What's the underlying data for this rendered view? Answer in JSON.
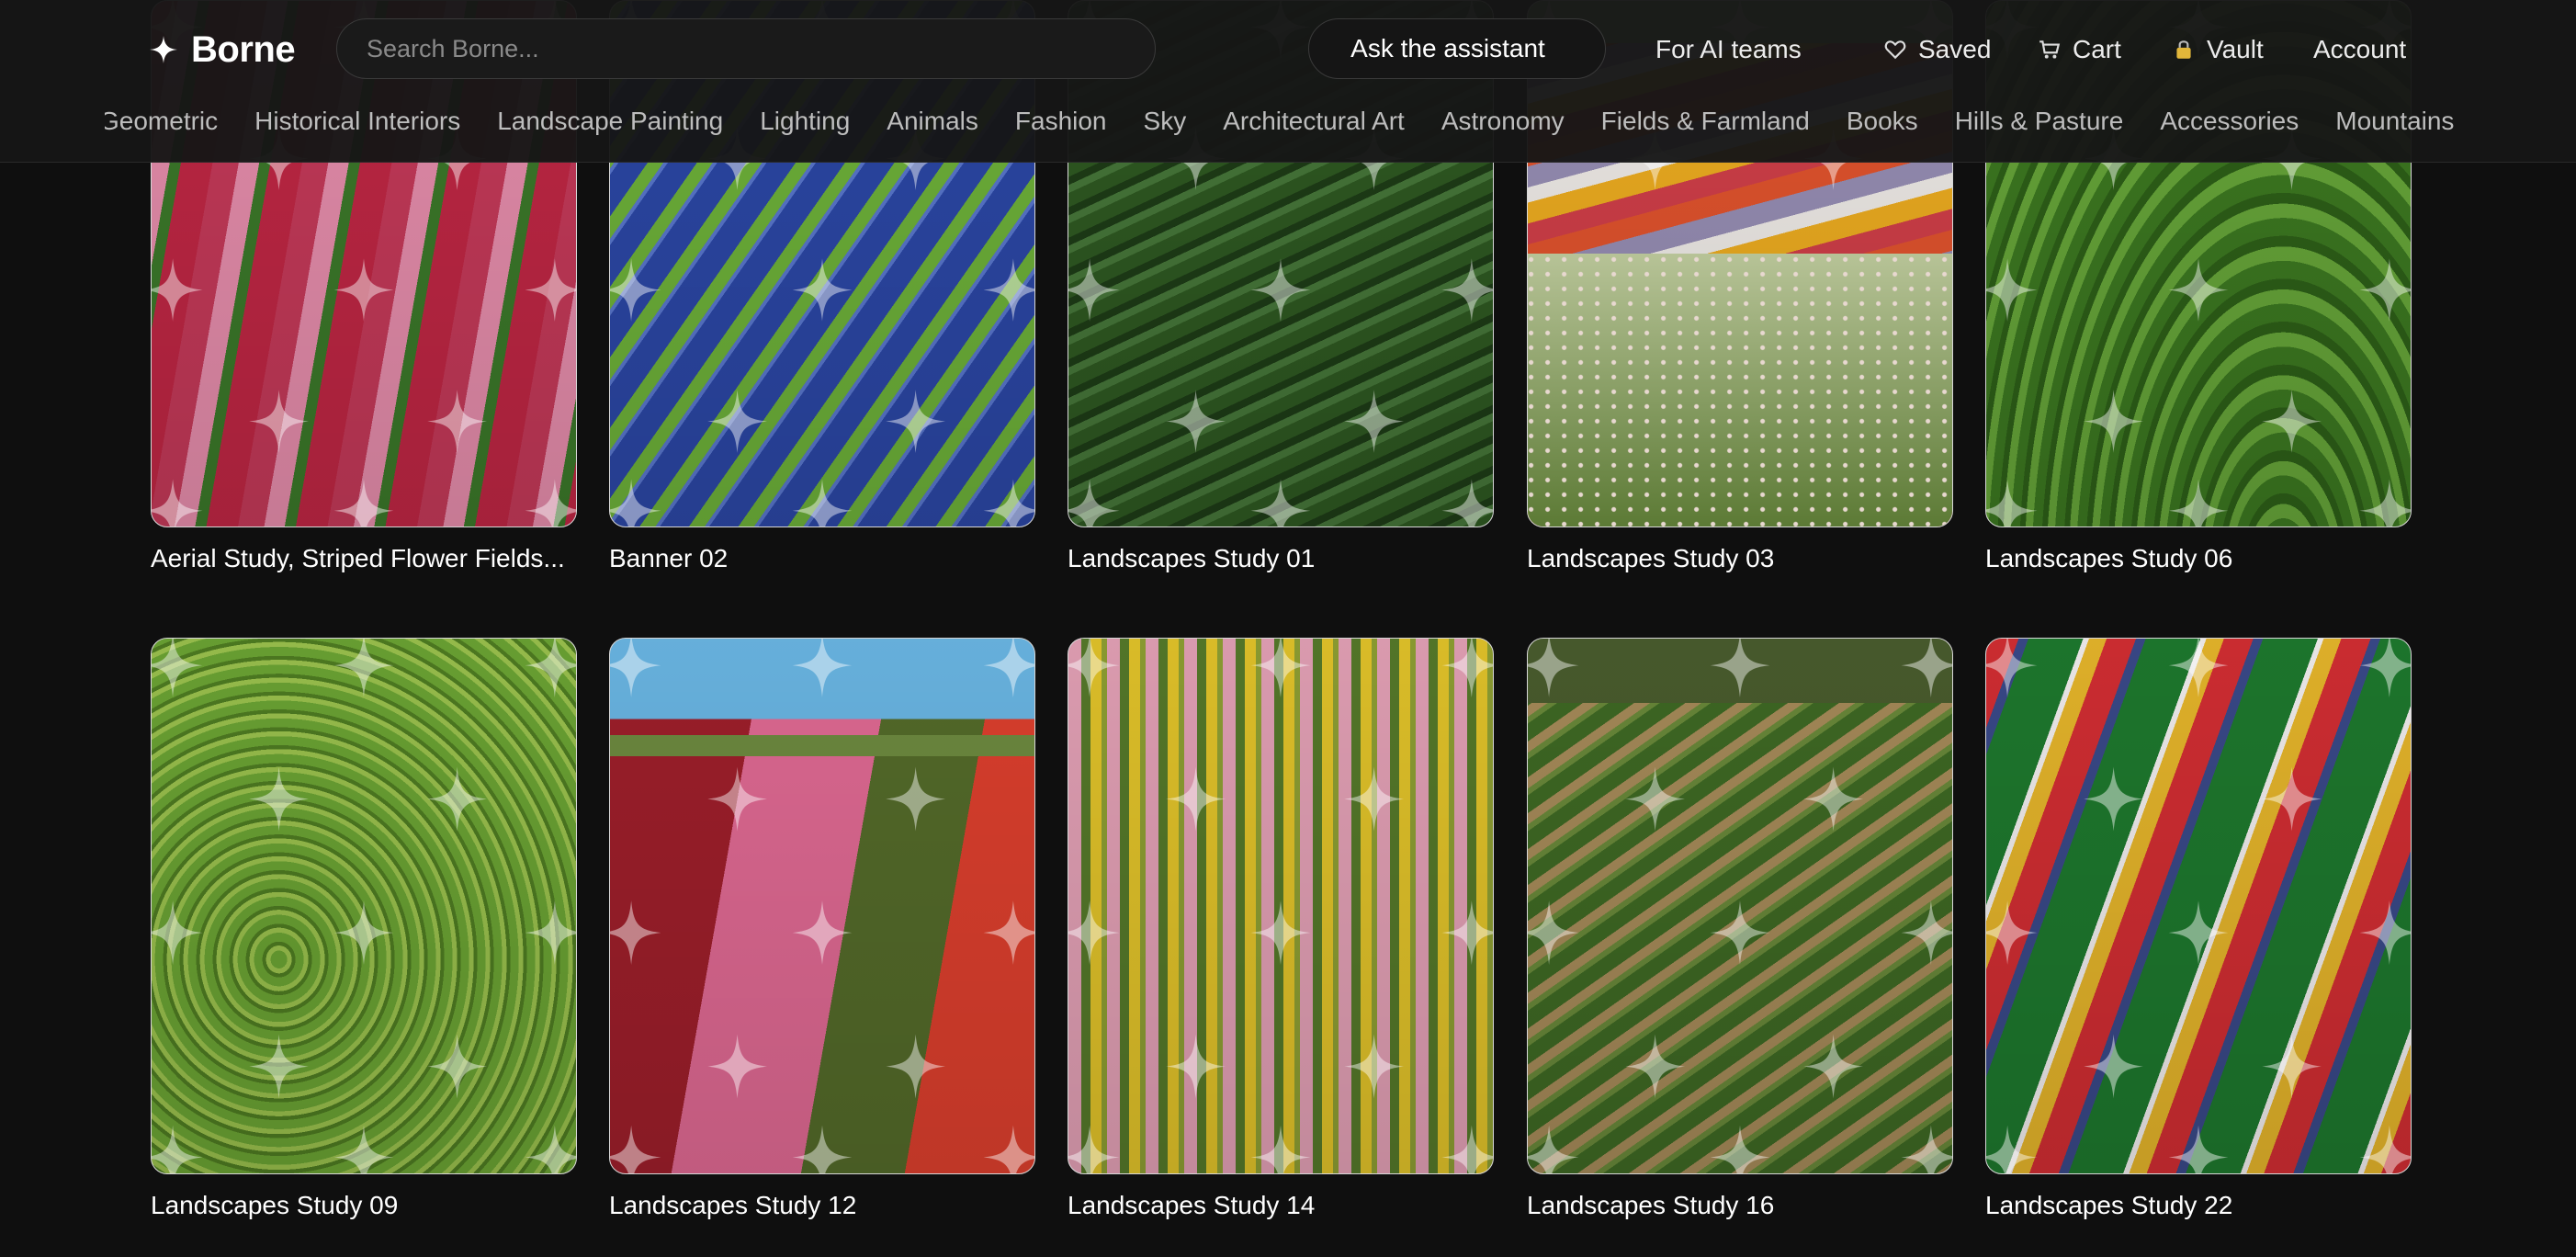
{
  "header": {
    "brand": "Borne",
    "search_placeholder": "Search Borne...",
    "assistant_label": "Ask the assistant",
    "ai_teams_label": "For AI teams",
    "saved_label": "Saved",
    "cart_label": "Cart",
    "vault_label": "Vault",
    "account_label": "Account"
  },
  "categories": [
    "Geometric",
    "Historical Interiors",
    "Landscape Painting",
    "Lighting",
    "Animals",
    "Fashion",
    "Sky",
    "Architectural Art",
    "Astronomy",
    "Fields & Farmland",
    "Books",
    "Hills & Pasture",
    "Accessories",
    "Mountains"
  ],
  "cards": [
    {
      "title": "Aerial Study, Striped Flower Fields..."
    },
    {
      "title": "Banner 02"
    },
    {
      "title": "Landscapes Study 01"
    },
    {
      "title": "Landscapes Study 03"
    },
    {
      "title": "Landscapes Study 06"
    },
    {
      "title": "Landscapes Study 09"
    },
    {
      "title": "Landscapes Study 12"
    },
    {
      "title": "Landscapes Study 14"
    },
    {
      "title": "Landscapes Study 16"
    },
    {
      "title": "Landscapes Study 22"
    }
  ]
}
